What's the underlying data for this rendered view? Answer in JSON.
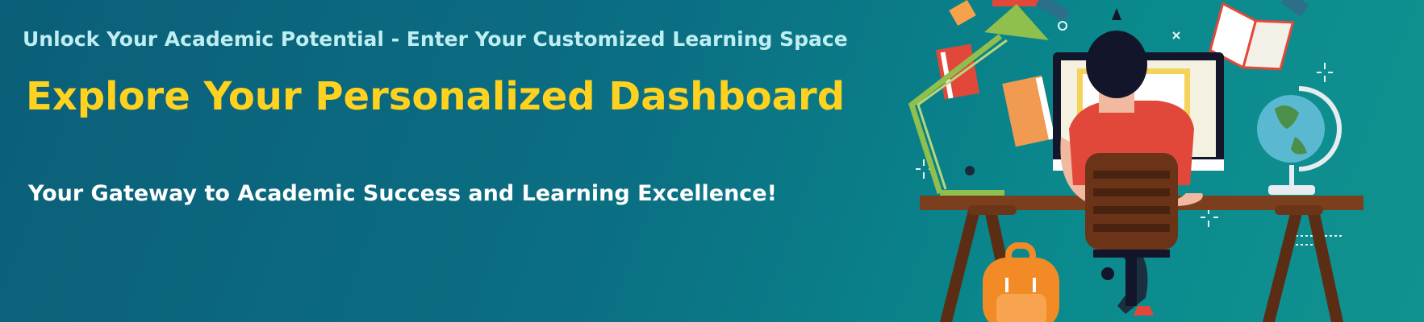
{
  "banner": {
    "subtitle": "Unlock Your Academic Potential - Enter Your Customized Learning Space",
    "headline": "Explore Your Personalized Dashboard",
    "tagline": "Your Gateway to Academic Success and Learning Excellence!"
  },
  "colors": {
    "background": "#0b6f83",
    "headline": "#ffd21f",
    "subtitle": "#bfeef2",
    "tagline": "#ffffff"
  },
  "illustration": {
    "icon": "student-at-desk-illustration"
  }
}
